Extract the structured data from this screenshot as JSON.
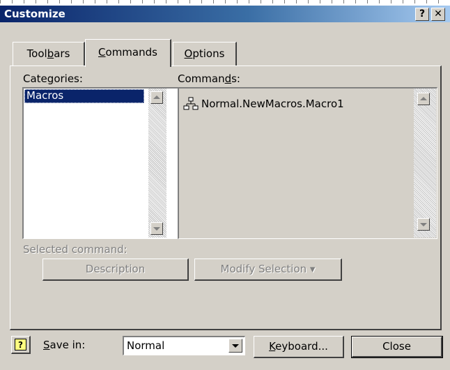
{
  "window": {
    "title": "Customize",
    "help_glyph": "?",
    "close_glyph": "✕"
  },
  "tabs": [
    {
      "label_pre": "Tool",
      "label_key": "b",
      "label_post": "ars"
    },
    {
      "label_pre": "",
      "label_key": "C",
      "label_post": "ommands"
    },
    {
      "label_pre": "",
      "label_key": "O",
      "label_post": "ptions"
    }
  ],
  "categories": {
    "label_pre": "Cate",
    "label_key": "g",
    "label_post": "ories:",
    "items": [
      "Macros"
    ]
  },
  "commands": {
    "label_pre": "Comman",
    "label_key": "d",
    "label_post": "s:",
    "items": [
      "Normal.NewMacros.Macro1"
    ]
  },
  "selected_command": {
    "label": "Selected command:",
    "description_button": "Description",
    "modify_button": "Modify Selection",
    "modify_arrow": "▾"
  },
  "footer": {
    "help_icon_glyph": "?",
    "save_in_pre": "",
    "save_in_key": "S",
    "save_in_post": "ave in:",
    "save_in_value": "Normal",
    "keyboard_key": "K",
    "keyboard_post": "eyboard...",
    "close_label": "Close"
  },
  "colors": {
    "title_start": "#0a246a",
    "title_end": "#a6caf0",
    "face": "#d4d0c8",
    "selection": "#0a246a"
  }
}
